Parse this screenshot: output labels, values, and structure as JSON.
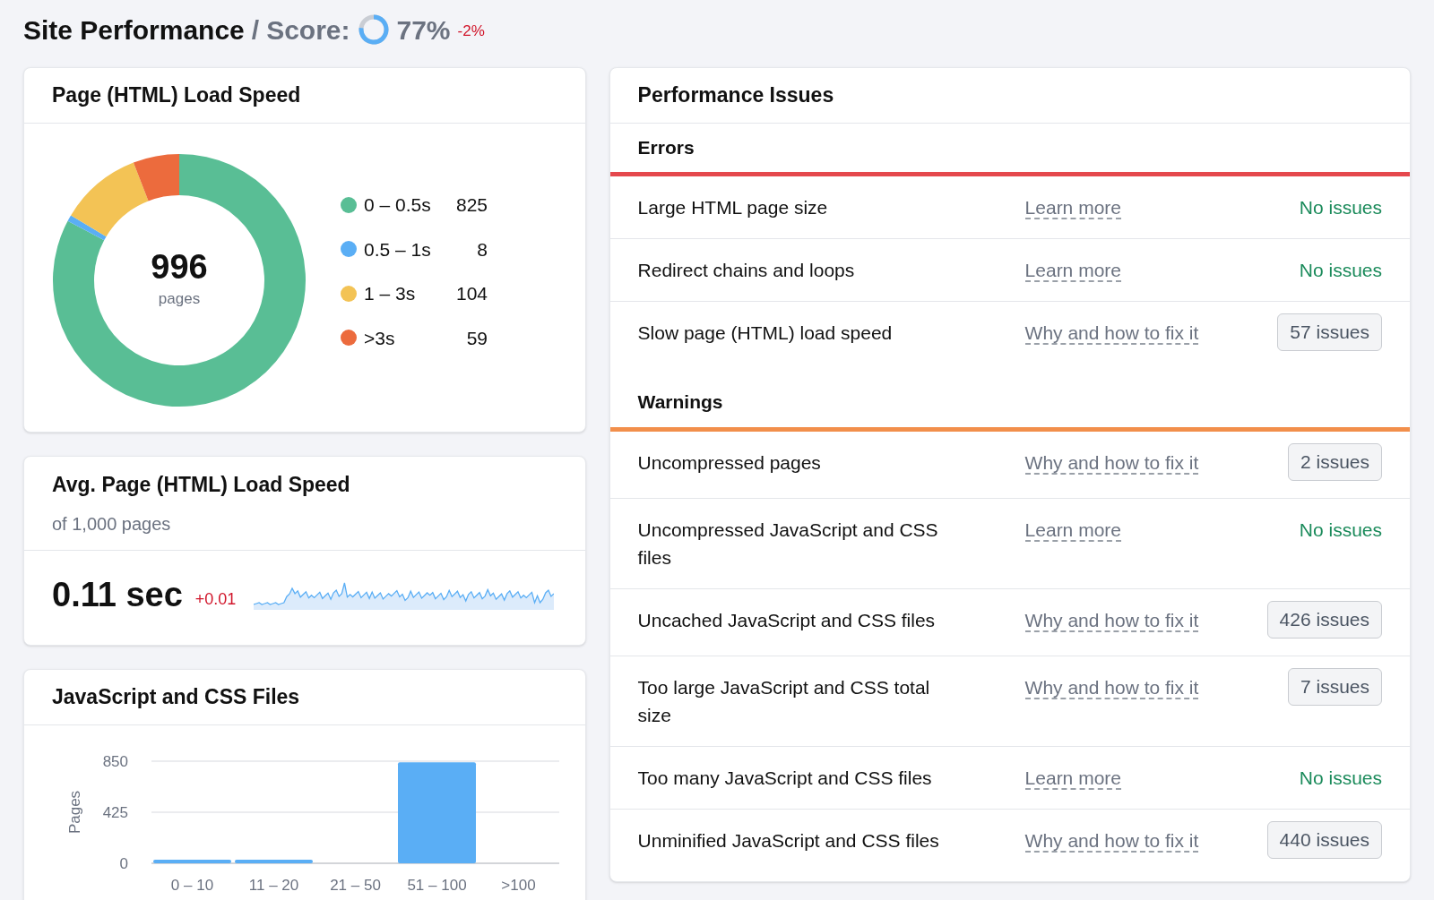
{
  "header": {
    "title": "Site Performance",
    "separator": "/",
    "score_label": "Score:",
    "score": "77%",
    "change": "-2%"
  },
  "load_speed": {
    "title": "Page (HTML) Load Speed",
    "total": "996",
    "total_label": "pages",
    "chart_data": {
      "type": "donut",
      "categories": [
        "0 – 0.5s",
        "0.5 – 1s",
        "1 – 3s",
        ">3s"
      ],
      "values": [
        82.8,
        0.8,
        10.5,
        5.9
      ],
      "colors": [
        "#59be95",
        "#5aaef5",
        "#f3c355",
        "#ec6b3d"
      ]
    },
    "legend_counts": [
      "825",
      "8",
      "104",
      "59"
    ]
  },
  "avg_speed": {
    "title": "Avg. Page (HTML) Load Speed",
    "subtitle": "of 1,000 pages",
    "value": "0.11 sec",
    "change": "+0.01"
  },
  "files": {
    "title": "JavaScript and CSS Files",
    "chart_data": {
      "type": "bar",
      "ylabel": "Pages",
      "categories": [
        "0 – 10",
        "11 – 20",
        "21 – 50",
        "51 – 100",
        ">100"
      ],
      "values": [
        30,
        30,
        0,
        840,
        0
      ],
      "ylim": [
        0,
        850
      ],
      "yticks": [
        0,
        425,
        850
      ]
    }
  },
  "issues": {
    "title": "Performance Issues",
    "sections": [
      {
        "title": "Errors",
        "color": "#e5484d",
        "rows": [
          {
            "name": "Large HTML page size",
            "link": "Learn more",
            "result": {
              "kind": "ok",
              "text": "No issues"
            }
          },
          {
            "name": "Redirect chains and loops",
            "link": "Learn more",
            "result": {
              "kind": "ok",
              "text": "No issues"
            }
          },
          {
            "name": "Slow page (HTML) load speed",
            "link": "Why and how to fix it",
            "result": {
              "kind": "count",
              "text": "57 issues"
            }
          }
        ]
      },
      {
        "title": "Warnings",
        "color": "#f28f4b",
        "rows": [
          {
            "name": "Uncompressed pages",
            "link": "Why and how to fix it",
            "result": {
              "kind": "count",
              "text": "2 issues"
            }
          },
          {
            "name": "Uncompressed JavaScript and CSS files",
            "link": "Learn more",
            "result": {
              "kind": "ok",
              "text": "No issues"
            }
          },
          {
            "name": "Uncached JavaScript and CSS files",
            "link": "Why and how to fix it",
            "result": {
              "kind": "count",
              "text": "426 issues"
            }
          },
          {
            "name": "Too large JavaScript and CSS total size",
            "link": "Why and how to fix it",
            "result": {
              "kind": "count",
              "text": "7 issues"
            }
          },
          {
            "name": "Too many JavaScript and CSS files",
            "link": "Learn more",
            "result": {
              "kind": "ok",
              "text": "No issues"
            }
          },
          {
            "name": "Unminified JavaScript and CSS files",
            "link": "Why and how to fix it",
            "result": {
              "kind": "count",
              "text": "440 issues"
            }
          }
        ]
      }
    ]
  }
}
